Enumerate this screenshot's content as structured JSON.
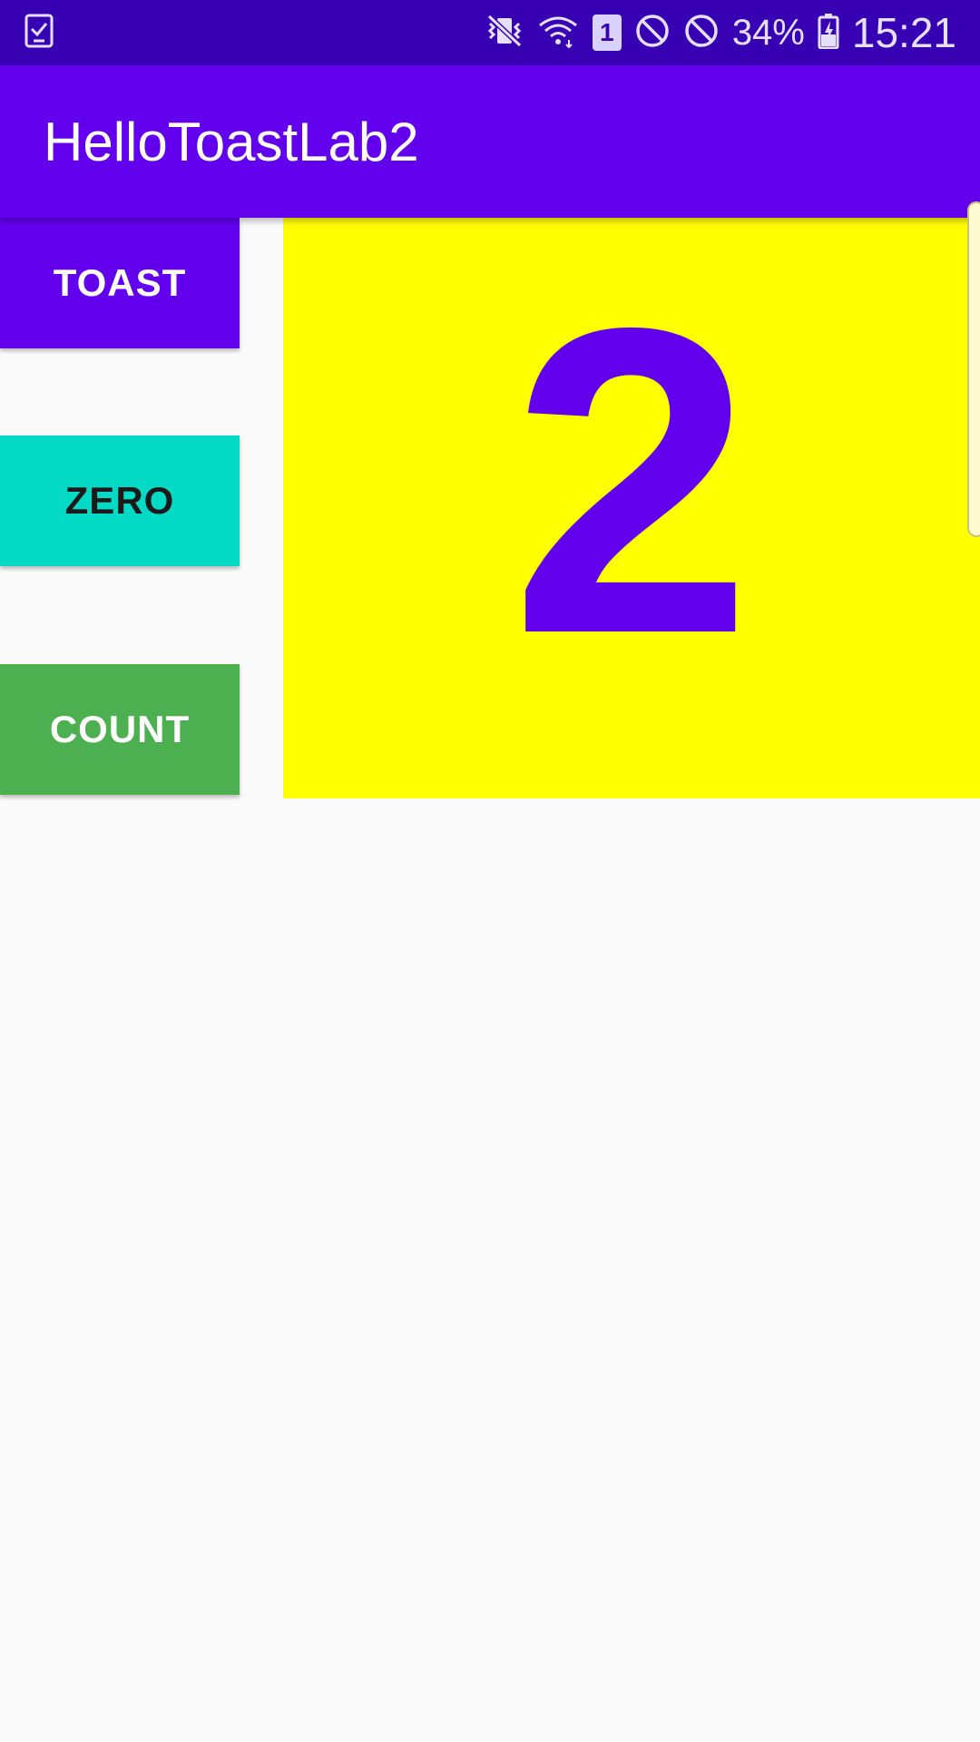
{
  "status_bar": {
    "left_icons": [
      "clipboard-check-icon"
    ],
    "right_icons": [
      "vibrate-mute-icon",
      "wifi-icon",
      "sim-icon",
      "block-icon",
      "block-icon",
      "battery-charging-icon"
    ],
    "sim_number": "1",
    "battery": "34%",
    "time": "15:21",
    "color": "#3700b3"
  },
  "app_bar": {
    "title": "HelloToastLab2",
    "color": "#6200ee"
  },
  "buttons": {
    "toast": "TOAST",
    "zero": "ZERO",
    "count": "COUNT"
  },
  "colors": {
    "toast": "#6200ee",
    "zero": "#03dac5",
    "count": "#4caf50",
    "panel_background": "#ffff00",
    "count_text": "#6200ee"
  },
  "counter": {
    "value": "2"
  }
}
